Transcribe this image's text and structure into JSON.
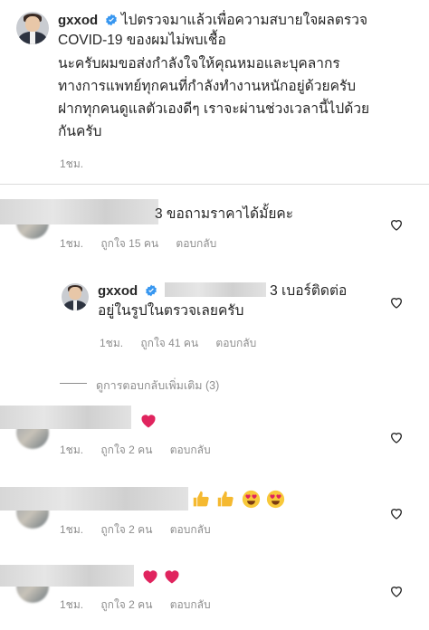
{
  "post": {
    "username": "gxxod",
    "caption": "ไปตรวจมาแล้วเพื่อความสบายใจผลตรวจ COVID-19 ของผมไม่พบเชื้อ นะครับผมขอส่งกำลังใจให้คุณหมอและบุคลากรทางการแพทย์ทุกคนที่กำลังทำงานหนักอยู่ด้วยครับ ฝากทุกคนดูแลตัวเองดีๆ เราจะผ่านช่วงเวลานี้ไปด้วยกันครับ",
    "line1": "ไปตรวจมาแล้วเพื่อความสบายใจผลตรวจ",
    "line2": "COVID-19 ของผมไม่พบเชื้อ",
    "line3": "นะครับผมขอส่งกำลังใจให้คุณหมอและบุคลากร",
    "line4": "ทางการแพทย์ทุกคนที่กำลังทำงานหนักอยู่ด้วยครับ",
    "line5": "ฝากทุกคนดูแลตัวเองดีๆ เราจะผ่านช่วงเวลานี้ไปด้วย",
    "line6": "กันครับ",
    "time": "1ชม."
  },
  "comments": [
    {
      "text_tail": "3 ขอถามราคาได้มั้ยคะ",
      "time": "1ชม.",
      "likes": "ถูกใจ 15 คน",
      "reply": "ตอบกลับ"
    },
    {
      "username": "gxxod",
      "text_tail": "3 เบอร์ติดต่อ",
      "text_line2": "อยู่ในรูปในตรวจเลยครับ",
      "time": "1ชม.",
      "likes": "ถูกใจ 41 คน",
      "reply": "ตอบกลับ"
    },
    {
      "emoji": [
        "red-heart"
      ],
      "time": "1ชม.",
      "likes": "ถูกใจ 2 คน",
      "reply": "ตอบกลับ"
    },
    {
      "emoji": [
        "thumbs-up",
        "thumbs-up",
        "heart-eyes",
        "heart-eyes"
      ],
      "time": "1ชม.",
      "likes": "ถูกใจ 2 คน",
      "reply": "ตอบกลับ"
    },
    {
      "emoji": [
        "red-heart",
        "red-heart"
      ],
      "time": "1ชม.",
      "likes": "ถูกใจ 2 คน",
      "reply": "ตอบกลับ"
    }
  ],
  "view_more_replies": "ดูการตอบกลับเพิ่มเติม (3)",
  "icons": {
    "verified": "verified-badge-icon",
    "like": "heart-outline-icon"
  },
  "colors": {
    "verified": "#3897f0",
    "red_heart": "#e0245e",
    "meta": "#8e8e8e"
  }
}
